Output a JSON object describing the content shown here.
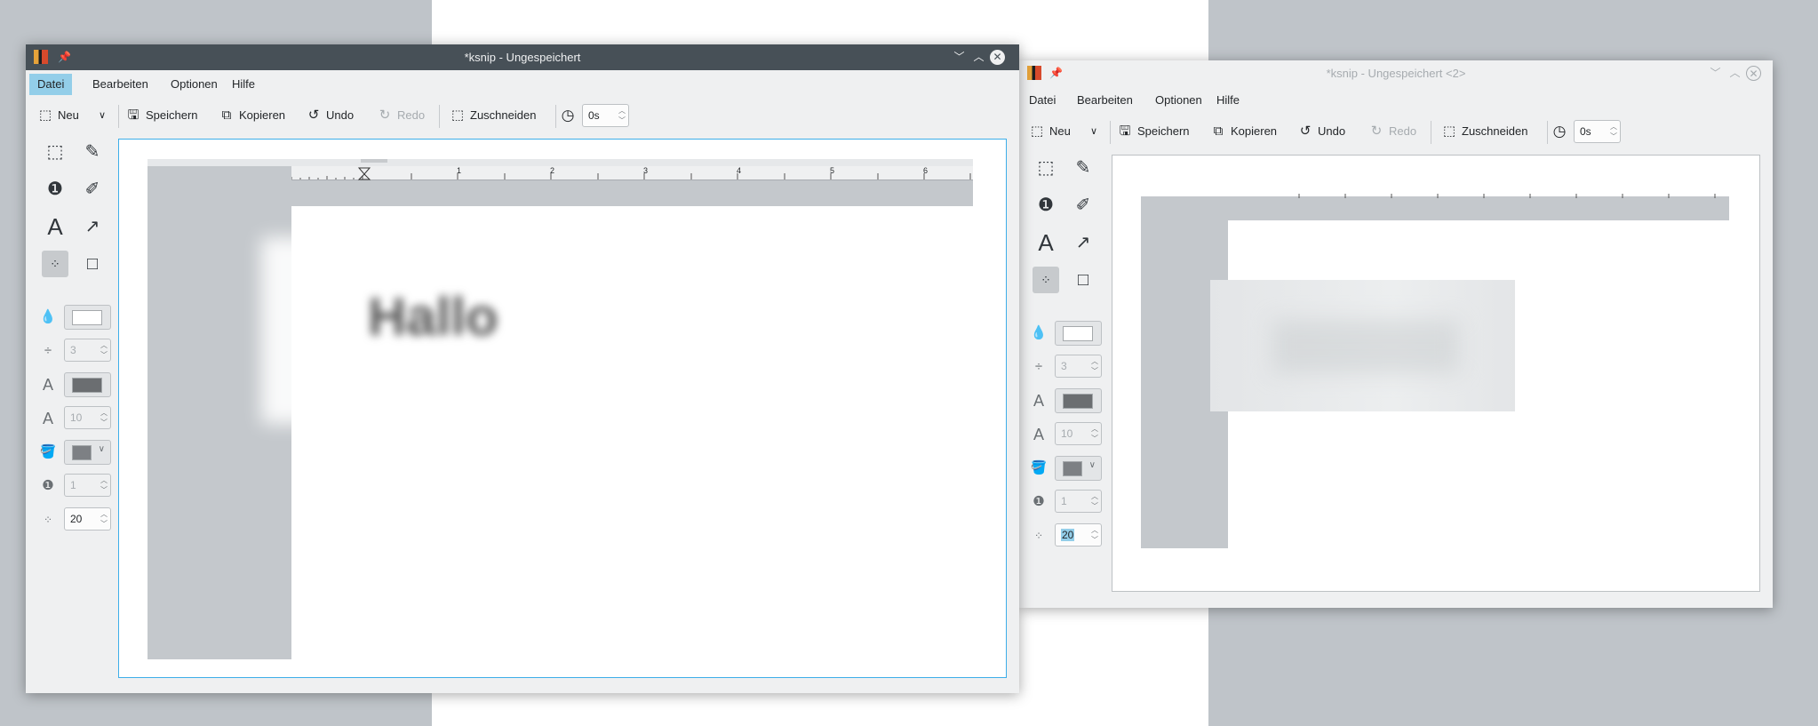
{
  "window1": {
    "title": "*ksnip - Ungespeichert",
    "menu": [
      "Datei",
      "Bearbeiten",
      "Optionen",
      "Hilfe"
    ],
    "toolbar": {
      "new_label": "Neu",
      "save_label": "Speichern",
      "copy_label": "Kopieren",
      "undo_label": "Undo",
      "redo_label": "Redo",
      "crop_label": "Zuschneiden",
      "delay_value": "0s"
    },
    "properties": {
      "width_value": "3",
      "font_size_value": "10",
      "number_value": "1",
      "blur_value": "20"
    },
    "ruler_numbers": [
      "1",
      "2",
      "3",
      "4",
      "5",
      "6"
    ],
    "canvas_text": "Hallo"
  },
  "window2": {
    "title": "*ksnip - Ungespeichert <2>",
    "menu": [
      "Datei",
      "Bearbeiten",
      "Optionen",
      "Hilfe"
    ],
    "toolbar": {
      "new_label": "Neu",
      "save_label": "Speichern",
      "copy_label": "Kopieren",
      "undo_label": "Undo",
      "redo_label": "Redo",
      "crop_label": "Zuschneiden",
      "delay_value": "0s"
    },
    "properties": {
      "width_value": "3",
      "font_size_value": "10",
      "number_value": "1",
      "blur_value": "20"
    }
  },
  "colors": {
    "titlebar_active": "#475057",
    "menu_highlight": "#93cee9",
    "canvas_focus_border": "#3daee9",
    "marker_fill": "#e3e5e7",
    "text_color_swatch": "#6b6e71",
    "fill_swatch": "#7d8084"
  }
}
